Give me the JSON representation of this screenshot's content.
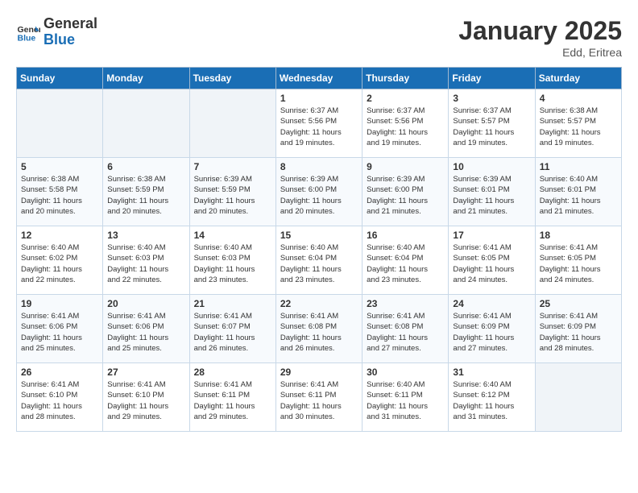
{
  "header": {
    "logo_line1": "General",
    "logo_line2": "Blue",
    "month": "January 2025",
    "location": "Edd, Eritrea"
  },
  "days_of_week": [
    "Sunday",
    "Monday",
    "Tuesday",
    "Wednesday",
    "Thursday",
    "Friday",
    "Saturday"
  ],
  "weeks": [
    [
      {
        "day": "",
        "info": ""
      },
      {
        "day": "",
        "info": ""
      },
      {
        "day": "",
        "info": ""
      },
      {
        "day": "1",
        "info": "Sunrise: 6:37 AM\nSunset: 5:56 PM\nDaylight: 11 hours\nand 19 minutes."
      },
      {
        "day": "2",
        "info": "Sunrise: 6:37 AM\nSunset: 5:56 PM\nDaylight: 11 hours\nand 19 minutes."
      },
      {
        "day": "3",
        "info": "Sunrise: 6:37 AM\nSunset: 5:57 PM\nDaylight: 11 hours\nand 19 minutes."
      },
      {
        "day": "4",
        "info": "Sunrise: 6:38 AM\nSunset: 5:57 PM\nDaylight: 11 hours\nand 19 minutes."
      }
    ],
    [
      {
        "day": "5",
        "info": "Sunrise: 6:38 AM\nSunset: 5:58 PM\nDaylight: 11 hours\nand 20 minutes."
      },
      {
        "day": "6",
        "info": "Sunrise: 6:38 AM\nSunset: 5:59 PM\nDaylight: 11 hours\nand 20 minutes."
      },
      {
        "day": "7",
        "info": "Sunrise: 6:39 AM\nSunset: 5:59 PM\nDaylight: 11 hours\nand 20 minutes."
      },
      {
        "day": "8",
        "info": "Sunrise: 6:39 AM\nSunset: 6:00 PM\nDaylight: 11 hours\nand 20 minutes."
      },
      {
        "day": "9",
        "info": "Sunrise: 6:39 AM\nSunset: 6:00 PM\nDaylight: 11 hours\nand 21 minutes."
      },
      {
        "day": "10",
        "info": "Sunrise: 6:39 AM\nSunset: 6:01 PM\nDaylight: 11 hours\nand 21 minutes."
      },
      {
        "day": "11",
        "info": "Sunrise: 6:40 AM\nSunset: 6:01 PM\nDaylight: 11 hours\nand 21 minutes."
      }
    ],
    [
      {
        "day": "12",
        "info": "Sunrise: 6:40 AM\nSunset: 6:02 PM\nDaylight: 11 hours\nand 22 minutes."
      },
      {
        "day": "13",
        "info": "Sunrise: 6:40 AM\nSunset: 6:03 PM\nDaylight: 11 hours\nand 22 minutes."
      },
      {
        "day": "14",
        "info": "Sunrise: 6:40 AM\nSunset: 6:03 PM\nDaylight: 11 hours\nand 23 minutes."
      },
      {
        "day": "15",
        "info": "Sunrise: 6:40 AM\nSunset: 6:04 PM\nDaylight: 11 hours\nand 23 minutes."
      },
      {
        "day": "16",
        "info": "Sunrise: 6:40 AM\nSunset: 6:04 PM\nDaylight: 11 hours\nand 23 minutes."
      },
      {
        "day": "17",
        "info": "Sunrise: 6:41 AM\nSunset: 6:05 PM\nDaylight: 11 hours\nand 24 minutes."
      },
      {
        "day": "18",
        "info": "Sunrise: 6:41 AM\nSunset: 6:05 PM\nDaylight: 11 hours\nand 24 minutes."
      }
    ],
    [
      {
        "day": "19",
        "info": "Sunrise: 6:41 AM\nSunset: 6:06 PM\nDaylight: 11 hours\nand 25 minutes."
      },
      {
        "day": "20",
        "info": "Sunrise: 6:41 AM\nSunset: 6:06 PM\nDaylight: 11 hours\nand 25 minutes."
      },
      {
        "day": "21",
        "info": "Sunrise: 6:41 AM\nSunset: 6:07 PM\nDaylight: 11 hours\nand 26 minutes."
      },
      {
        "day": "22",
        "info": "Sunrise: 6:41 AM\nSunset: 6:08 PM\nDaylight: 11 hours\nand 26 minutes."
      },
      {
        "day": "23",
        "info": "Sunrise: 6:41 AM\nSunset: 6:08 PM\nDaylight: 11 hours\nand 27 minutes."
      },
      {
        "day": "24",
        "info": "Sunrise: 6:41 AM\nSunset: 6:09 PM\nDaylight: 11 hours\nand 27 minutes."
      },
      {
        "day": "25",
        "info": "Sunrise: 6:41 AM\nSunset: 6:09 PM\nDaylight: 11 hours\nand 28 minutes."
      }
    ],
    [
      {
        "day": "26",
        "info": "Sunrise: 6:41 AM\nSunset: 6:10 PM\nDaylight: 11 hours\nand 28 minutes."
      },
      {
        "day": "27",
        "info": "Sunrise: 6:41 AM\nSunset: 6:10 PM\nDaylight: 11 hours\nand 29 minutes."
      },
      {
        "day": "28",
        "info": "Sunrise: 6:41 AM\nSunset: 6:11 PM\nDaylight: 11 hours\nand 29 minutes."
      },
      {
        "day": "29",
        "info": "Sunrise: 6:41 AM\nSunset: 6:11 PM\nDaylight: 11 hours\nand 30 minutes."
      },
      {
        "day": "30",
        "info": "Sunrise: 6:40 AM\nSunset: 6:11 PM\nDaylight: 11 hours\nand 31 minutes."
      },
      {
        "day": "31",
        "info": "Sunrise: 6:40 AM\nSunset: 6:12 PM\nDaylight: 11 hours\nand 31 minutes."
      },
      {
        "day": "",
        "info": ""
      }
    ]
  ]
}
